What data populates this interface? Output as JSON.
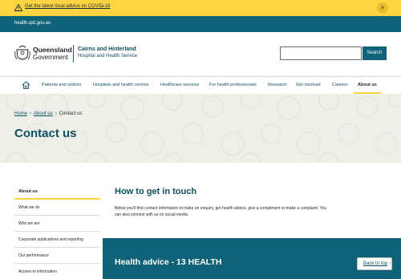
{
  "alert": {
    "link_text": "Get the latest local advice on COVID-19",
    "arrow": "→",
    "close": "×"
  },
  "topbar": {
    "domain": "health.qld.gov.au"
  },
  "header": {
    "qld_line1": "Queensland",
    "qld_line2": "Government",
    "hhs_line1": "Cairns and Hinterland",
    "hhs_line2": "Hospital and Health Service",
    "search_button": "Search",
    "search_placeholder": ""
  },
  "nav": {
    "items": [
      "Patients and visitors",
      "Hospitals and health centres",
      "Healthcare services",
      "For health professionals",
      "Research",
      "Get involved",
      "Careers",
      "About us"
    ],
    "active": "About us"
  },
  "breadcrumb": {
    "home": "Home",
    "sep1": "›",
    "about": "About us",
    "sep2": "›",
    "current": "Contact us"
  },
  "page_title": "Contact us",
  "sidebar": {
    "items": [
      "About us",
      "What we do",
      "Who we are",
      "Corporate publications and reporting",
      "Our performance",
      "Access to information"
    ]
  },
  "main": {
    "heading": "How to get in touch",
    "intro": "Below you'll find contact information to make an enquiry, get health advice, give a compliment or make a complaint. You can also connect with us on social media."
  },
  "advice": {
    "title": "Health advice - 13 HEALTH"
  },
  "back_to_top": {
    "label": "Back to top",
    "arrow": "↑"
  },
  "colors": {
    "alert_bg": "#fdd441",
    "brand_teal": "#0f6277",
    "heading_teal": "#0f4e60",
    "hero_bg": "#efefea"
  }
}
